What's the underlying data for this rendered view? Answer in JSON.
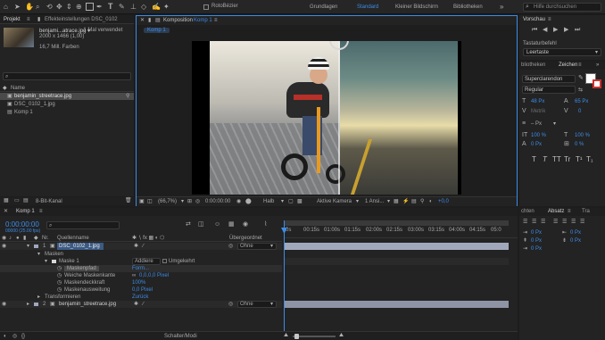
{
  "toolbar": {
    "rotobezier_label": "RotoBézier",
    "workspaces": [
      "Grundlagen",
      "Standard",
      "Kleiner Bildschirm",
      "Bibliotheken"
    ],
    "active_workspace": "Standard",
    "search_placeholder": "Hilfe durchsuchen"
  },
  "project": {
    "tab_label": "Projekt",
    "effects_tab_label": "Effekteinstellungen DSC_0102",
    "selected_name": "benjami...atrace.jpg ▾",
    "selected_usage": ", 1 Mal verwendet",
    "selected_dims": "2000 x 1466 (1,00)",
    "selected_colors": "16,7 Mill. Farben",
    "name_header": "Name",
    "items": [
      {
        "name": "benjamin_streetrace.jpg",
        "type": "image"
      },
      {
        "name": "DSC_0102_1.jpg",
        "type": "image"
      },
      {
        "name": "Komp 1",
        "type": "comp"
      }
    ],
    "bit_depth": "8-Bit-Kanal"
  },
  "composition": {
    "tab_prefix": "Komposition",
    "tab_name": "Komp 1",
    "chip_label": "Komp 1",
    "zoom": "(66,7%)",
    "timecode": "0:00:00:00",
    "resolution": "Halb",
    "camera": "Aktive Kamera",
    "views": "1 Ansi...",
    "exposure": "+0,0"
  },
  "preview": {
    "title": "Vorschau",
    "shortcut_label": "Tastaturbefehl",
    "shortcut_value": "Leertaste"
  },
  "character": {
    "tab_library": "bliotheken",
    "tab_character": "Zeichen",
    "font": "Superclarendon",
    "style": "Regular",
    "size": "48 Px",
    "leading": "65 Px",
    "kerning": "Metrik",
    "tracking": "0",
    "stroke_unit": "– Px",
    "v_scale": "100 %",
    "h_scale": "100 %",
    "baseline": "0 Px",
    "tsume": "0 %",
    "text_style_buttons": [
      "T",
      "T",
      "TT",
      "Tr",
      "T¹",
      "T₁"
    ]
  },
  "paragraph": {
    "tabs": [
      "chten",
      "Absatz",
      "Tra"
    ],
    "active_tab": "Absatz",
    "values": [
      "0 Px",
      "0 Px",
      "0 Px",
      "0 Px",
      "0 Px"
    ]
  },
  "timeline": {
    "tab_label": "Komp 1",
    "timecode": "0:00:00:00",
    "fps_info": "00000 (25.00 fps)",
    "search_placeholder": "",
    "col_nr": "Nr.",
    "col_source": "Quellenname",
    "col_parent": "Übergeordnet",
    "ruler_ticks": [
      "0s",
      "00:15s",
      "01:00s",
      "01:15s",
      "02:00s",
      "02:15s",
      "03:00s",
      "03:15s",
      "04:00s",
      "04:15s",
      "05:0"
    ],
    "layers": [
      {
        "index": "1",
        "name": "DSC_0102_1.jpg",
        "parent": "Ohne"
      },
      {
        "index": "2",
        "name": "benjamin_streetrace.jpg",
        "parent": "Ohne"
      }
    ],
    "masks_label": "Masken",
    "mask1_label": "Maske 1",
    "mask_mode": "Addiere",
    "mask_inverted": "Umgekehrt",
    "mask_props": [
      {
        "label": "Maskenpfad",
        "value": "Form..."
      },
      {
        "label": "Weiche Maskenkante",
        "value": "0,0,0,0 Pixel"
      },
      {
        "label": "Maskendeckkraft",
        "value": "100%"
      },
      {
        "label": "Maskenausweitung",
        "value": "0,0 Pixel"
      }
    ],
    "transform_label": "Transformieren",
    "transform_reset": "Zurück",
    "footer_label": "Schalter/Modi"
  },
  "colors": {
    "accent_blue": "#3c8ce7",
    "layer1_label": "#9fa8c0",
    "layer2_label": "#9fa8c0",
    "playhead": "#3c8ce7"
  }
}
